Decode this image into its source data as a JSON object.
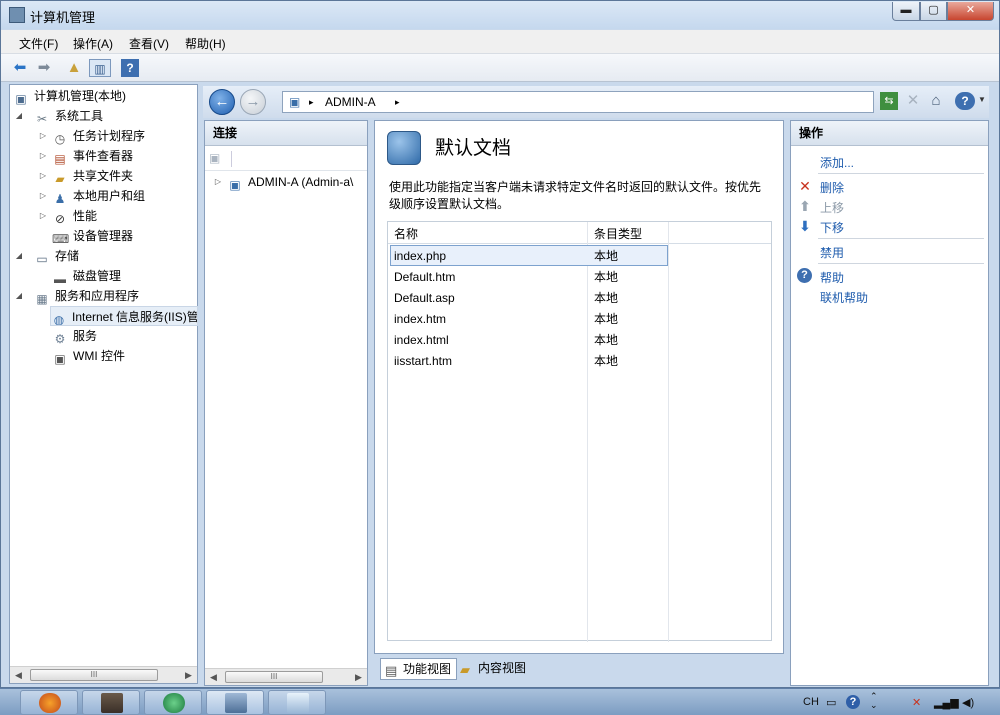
{
  "window": {
    "title": "计算机管理",
    "min": "▬",
    "max": "▢",
    "close": "✕"
  },
  "menu": [
    {
      "label": "文件(F)"
    },
    {
      "label": "操作(A)"
    },
    {
      "label": "查看(V)"
    },
    {
      "label": "帮助(H)"
    }
  ],
  "toolbar": {
    "icons": [
      "back-arrow-icon",
      "forward-arrow-icon",
      "up-folder-icon",
      "show-hide-tree-icon",
      "help-book-icon"
    ]
  },
  "tree": {
    "root": "计算机管理(本地)",
    "system_tools": "系统工具",
    "task_scheduler": "任务计划程序",
    "event_viewer": "事件查看器",
    "shared_folders": "共享文件夹",
    "local_users": "本地用户和组",
    "performance": "性能",
    "device_manager": "设备管理器",
    "storage": "存储",
    "disk_management": "磁盘管理",
    "services_apps": "服务和应用程序",
    "iis": "Internet 信息服务(IIS)管",
    "services": "服务",
    "wmi": "WMI 控件"
  },
  "address": {
    "crumb": "ADMIN-A",
    "sep": "▸"
  },
  "connections": {
    "title": "连接",
    "server_node": "ADMIN-A (Admin-a\\"
  },
  "feature": {
    "title": "默认文档",
    "description": "使用此功能指定当客户端未请求特定文件名时返回的默认文件。按优先级顺序设置默认文档。",
    "columns": {
      "name": "名称",
      "type": "条目类型"
    },
    "rows": [
      {
        "name": "index.php",
        "type": "本地"
      },
      {
        "name": "Default.htm",
        "type": "本地"
      },
      {
        "name": "Default.asp",
        "type": "本地"
      },
      {
        "name": "index.htm",
        "type": "本地"
      },
      {
        "name": "index.html",
        "type": "本地"
      },
      {
        "name": "iisstart.htm",
        "type": "本地"
      }
    ],
    "tab_features": "功能视图",
    "tab_content": "内容视图"
  },
  "actions": {
    "title": "操作",
    "add": "添加...",
    "remove": "删除",
    "move_up": "上移",
    "move_down": "下移",
    "disable": "禁用",
    "help": "帮助",
    "online_help": "联机帮助"
  },
  "taskbar": {
    "lang": "CH"
  },
  "colors": {
    "link": "#1f5cad",
    "disabled": "#8c9aa8",
    "selection": "#e8f0fb",
    "chrome": "#c9d9ec"
  }
}
